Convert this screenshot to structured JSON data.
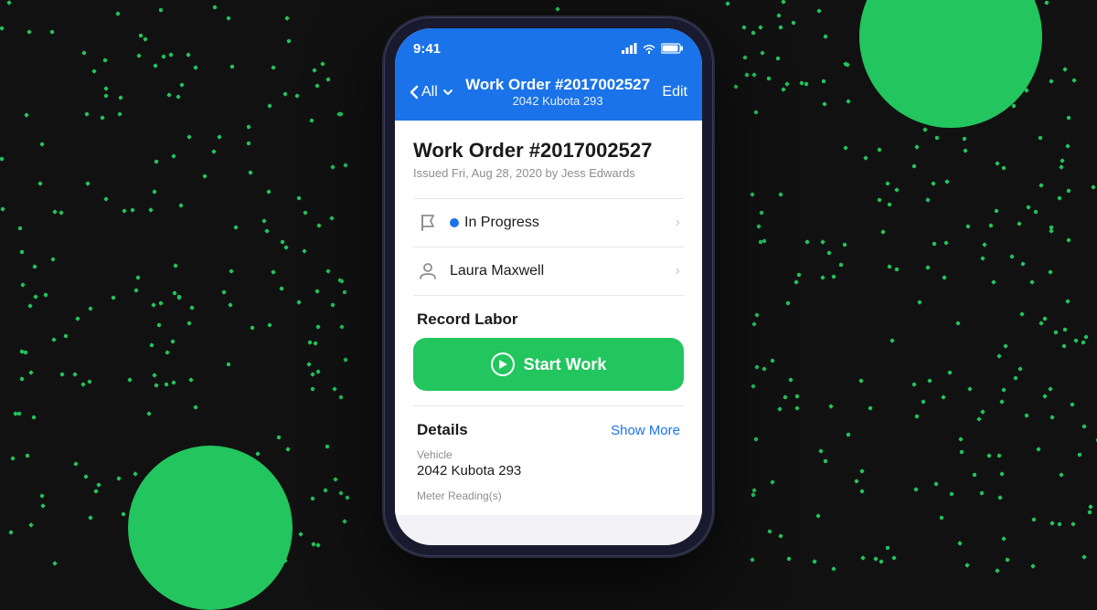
{
  "background": {
    "color": "#111111"
  },
  "status_bar": {
    "time": "9:41",
    "signal_icon": "📶",
    "wifi_icon": "WiFi",
    "battery_icon": "🔋"
  },
  "nav": {
    "back_label": "All",
    "title": "Work Order #2017002527",
    "subtitle": "2042 Kubota 293",
    "edit_label": "Edit"
  },
  "work_order": {
    "title": "Work Order #2017002527",
    "issued_text": "Issued Fri, Aug 28, 2020 by Jess Edwards"
  },
  "status_row": {
    "status_label": "In Progress",
    "status_dot_color": "#1a73e8"
  },
  "assignee_row": {
    "assignee_name": "Laura Maxwell"
  },
  "record_labor": {
    "section_title": "Record Labor",
    "start_work_label": "Start Work"
  },
  "details": {
    "section_title": "Details",
    "show_more_label": "Show More",
    "vehicle_label": "Vehicle",
    "vehicle_value": "2042 Kubota 293",
    "meter_label": "Meter Reading(s)"
  },
  "colors": {
    "blue": "#1a73e8",
    "green": "#22c55e",
    "dark": "#1a1a1a",
    "gray": "#8e8e93",
    "light_gray": "#e5e5ea"
  }
}
